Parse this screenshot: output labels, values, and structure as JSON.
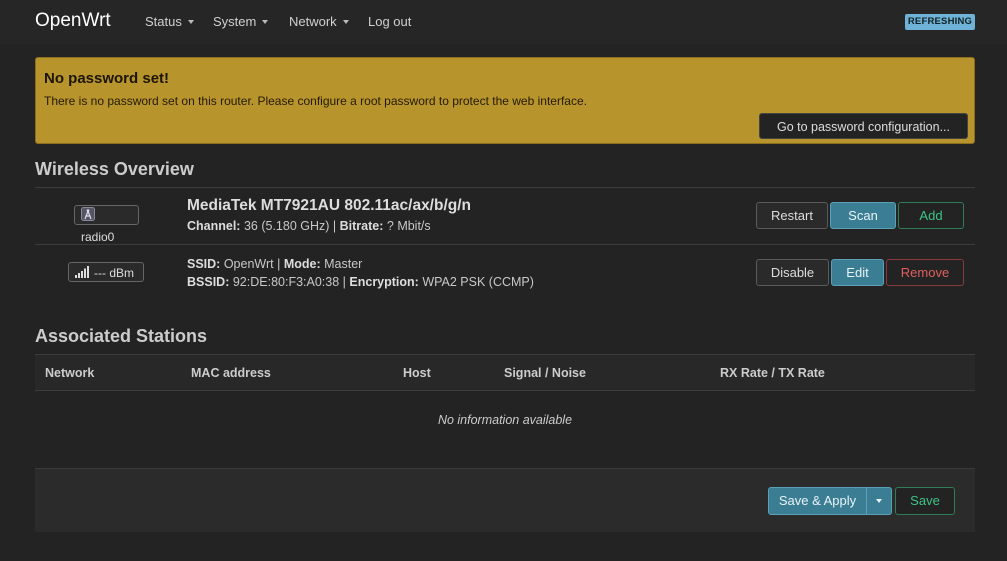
{
  "header": {
    "brand": "OpenWrt",
    "menu": [
      {
        "label": "Status"
      },
      {
        "label": "System"
      },
      {
        "label": "Network"
      },
      {
        "label": "Log out"
      }
    ],
    "refresh_badge": "REFRESHING"
  },
  "alert": {
    "title": "No password set!",
    "text": "There is no password set on this router. Please configure a root password to protect the web interface.",
    "button": "Go to password configuration..."
  },
  "wireless": {
    "title": "Wireless Overview",
    "radio": {
      "badge": "radio0",
      "device": "MediaTek MT7921AU 802.11ac/ax/b/g/n",
      "channel_label": "Channel:",
      "channel_value": "36 (5.180 GHz)",
      "bitrate_label": "Bitrate:",
      "bitrate_value": "? Mbit/s",
      "buttons": {
        "restart": "Restart",
        "scan": "Scan",
        "add": "Add"
      }
    },
    "network": {
      "signal_badge": "--- dBm",
      "ssid_label": "SSID:",
      "ssid_value": "OpenWrt",
      "mode_label": "Mode:",
      "mode_value": "Master",
      "bssid_label": "BSSID:",
      "bssid_value": "92:DE:80:F3:A0:38",
      "encryption_label": "Encryption:",
      "encryption_value": "WPA2 PSK (CCMP)",
      "buttons": {
        "disable": "Disable",
        "edit": "Edit",
        "remove": "Remove"
      }
    }
  },
  "stations": {
    "title": "Associated Stations",
    "columns": [
      "Network",
      "MAC address",
      "Host",
      "Signal / Noise",
      "RX Rate / TX Rate"
    ],
    "empty": "No information available"
  },
  "footer": {
    "save_apply": "Save & Apply",
    "save": "Save"
  },
  "colors": {
    "background": "#232323",
    "alert": "#b8942c",
    "accent_blue": "#3b7d93",
    "accent_green": "#3ec387",
    "accent_red": "#e06060",
    "refresh_badge": "#6fb2d8"
  }
}
